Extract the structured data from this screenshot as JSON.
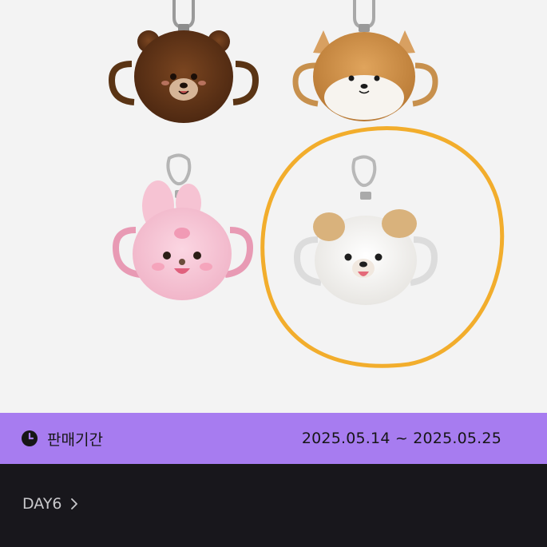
{
  "colors": {
    "sale_bar": "#a77cf0",
    "highlight_circle": "#f2ad2c",
    "dark_footer": "#18171c"
  },
  "sale_period": {
    "icon": "clock-icon",
    "label": "판매기간",
    "dates": "2025.05.14 ~ 2025.05.25"
  },
  "artist": {
    "name": "DAY6",
    "icon": "chevron-right-icon"
  },
  "products": [
    {
      "name": "brown-bear",
      "highlighted": false
    },
    {
      "name": "shiba-dog",
      "highlighted": false
    },
    {
      "name": "pink-bunny",
      "highlighted": false
    },
    {
      "name": "white-puppy",
      "highlighted": true
    }
  ]
}
